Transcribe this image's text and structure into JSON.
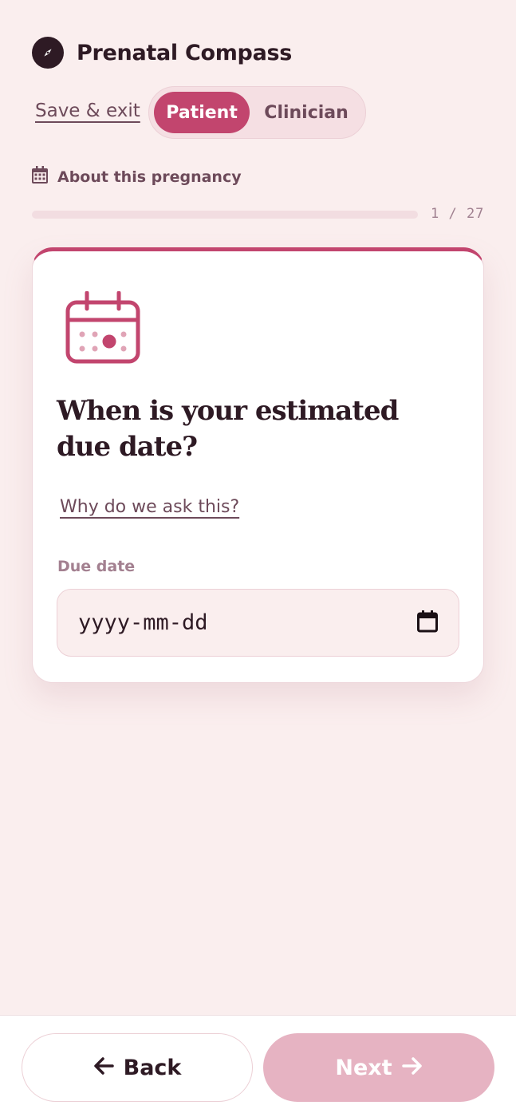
{
  "app": {
    "title": "Prenatal Compass",
    "logo_icon": "compass-icon"
  },
  "header": {
    "save_exit_label": "Save & exit",
    "mode_toggle": {
      "options": [
        "Patient",
        "Clinician"
      ],
      "selected": "Patient"
    }
  },
  "section": {
    "icon": "calendar-icon",
    "label": "About this pregnancy"
  },
  "progress": {
    "current": 1,
    "total": 27,
    "text": "1 / 27",
    "fraction": 0.0
  },
  "question": {
    "icon": "calendar-icon",
    "title": "When is your estimated due date?",
    "help_link": "Why do we ask this?",
    "field_label": "Due date",
    "placeholder": "yyyy-mm-dd",
    "value": ""
  },
  "footer": {
    "back_label": "Back",
    "next_label": "Next",
    "next_enabled": false
  },
  "colors": {
    "accent": "#c2456e",
    "background": "#faeeee",
    "text": "#2e1a24",
    "muted": "#6d4a5a",
    "next_disabled": "#e6b3c2"
  }
}
